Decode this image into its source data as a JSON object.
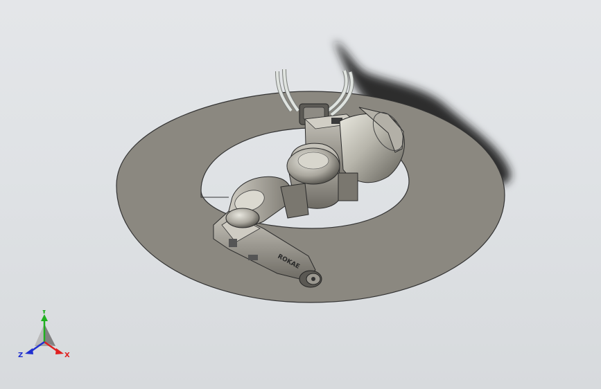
{
  "viewport": {
    "background_top": "#e4e6e9",
    "background_bottom": "#d7dadd"
  },
  "model": {
    "plate_color": "#8b8880",
    "plate_edge_color": "#333333",
    "housing_color": "#9a978f",
    "motor_color": "#b8b6ac",
    "tubing_color": "#d9ddd9",
    "shadow_color": "#2a2a2a",
    "arm_plate_labels": [
      "ROKAE"
    ]
  },
  "triad": {
    "x_label": "X",
    "y_label": "Y",
    "z_label": "Z",
    "x_color": "#e02020",
    "y_color": "#20b020",
    "z_color": "#2030d0"
  }
}
